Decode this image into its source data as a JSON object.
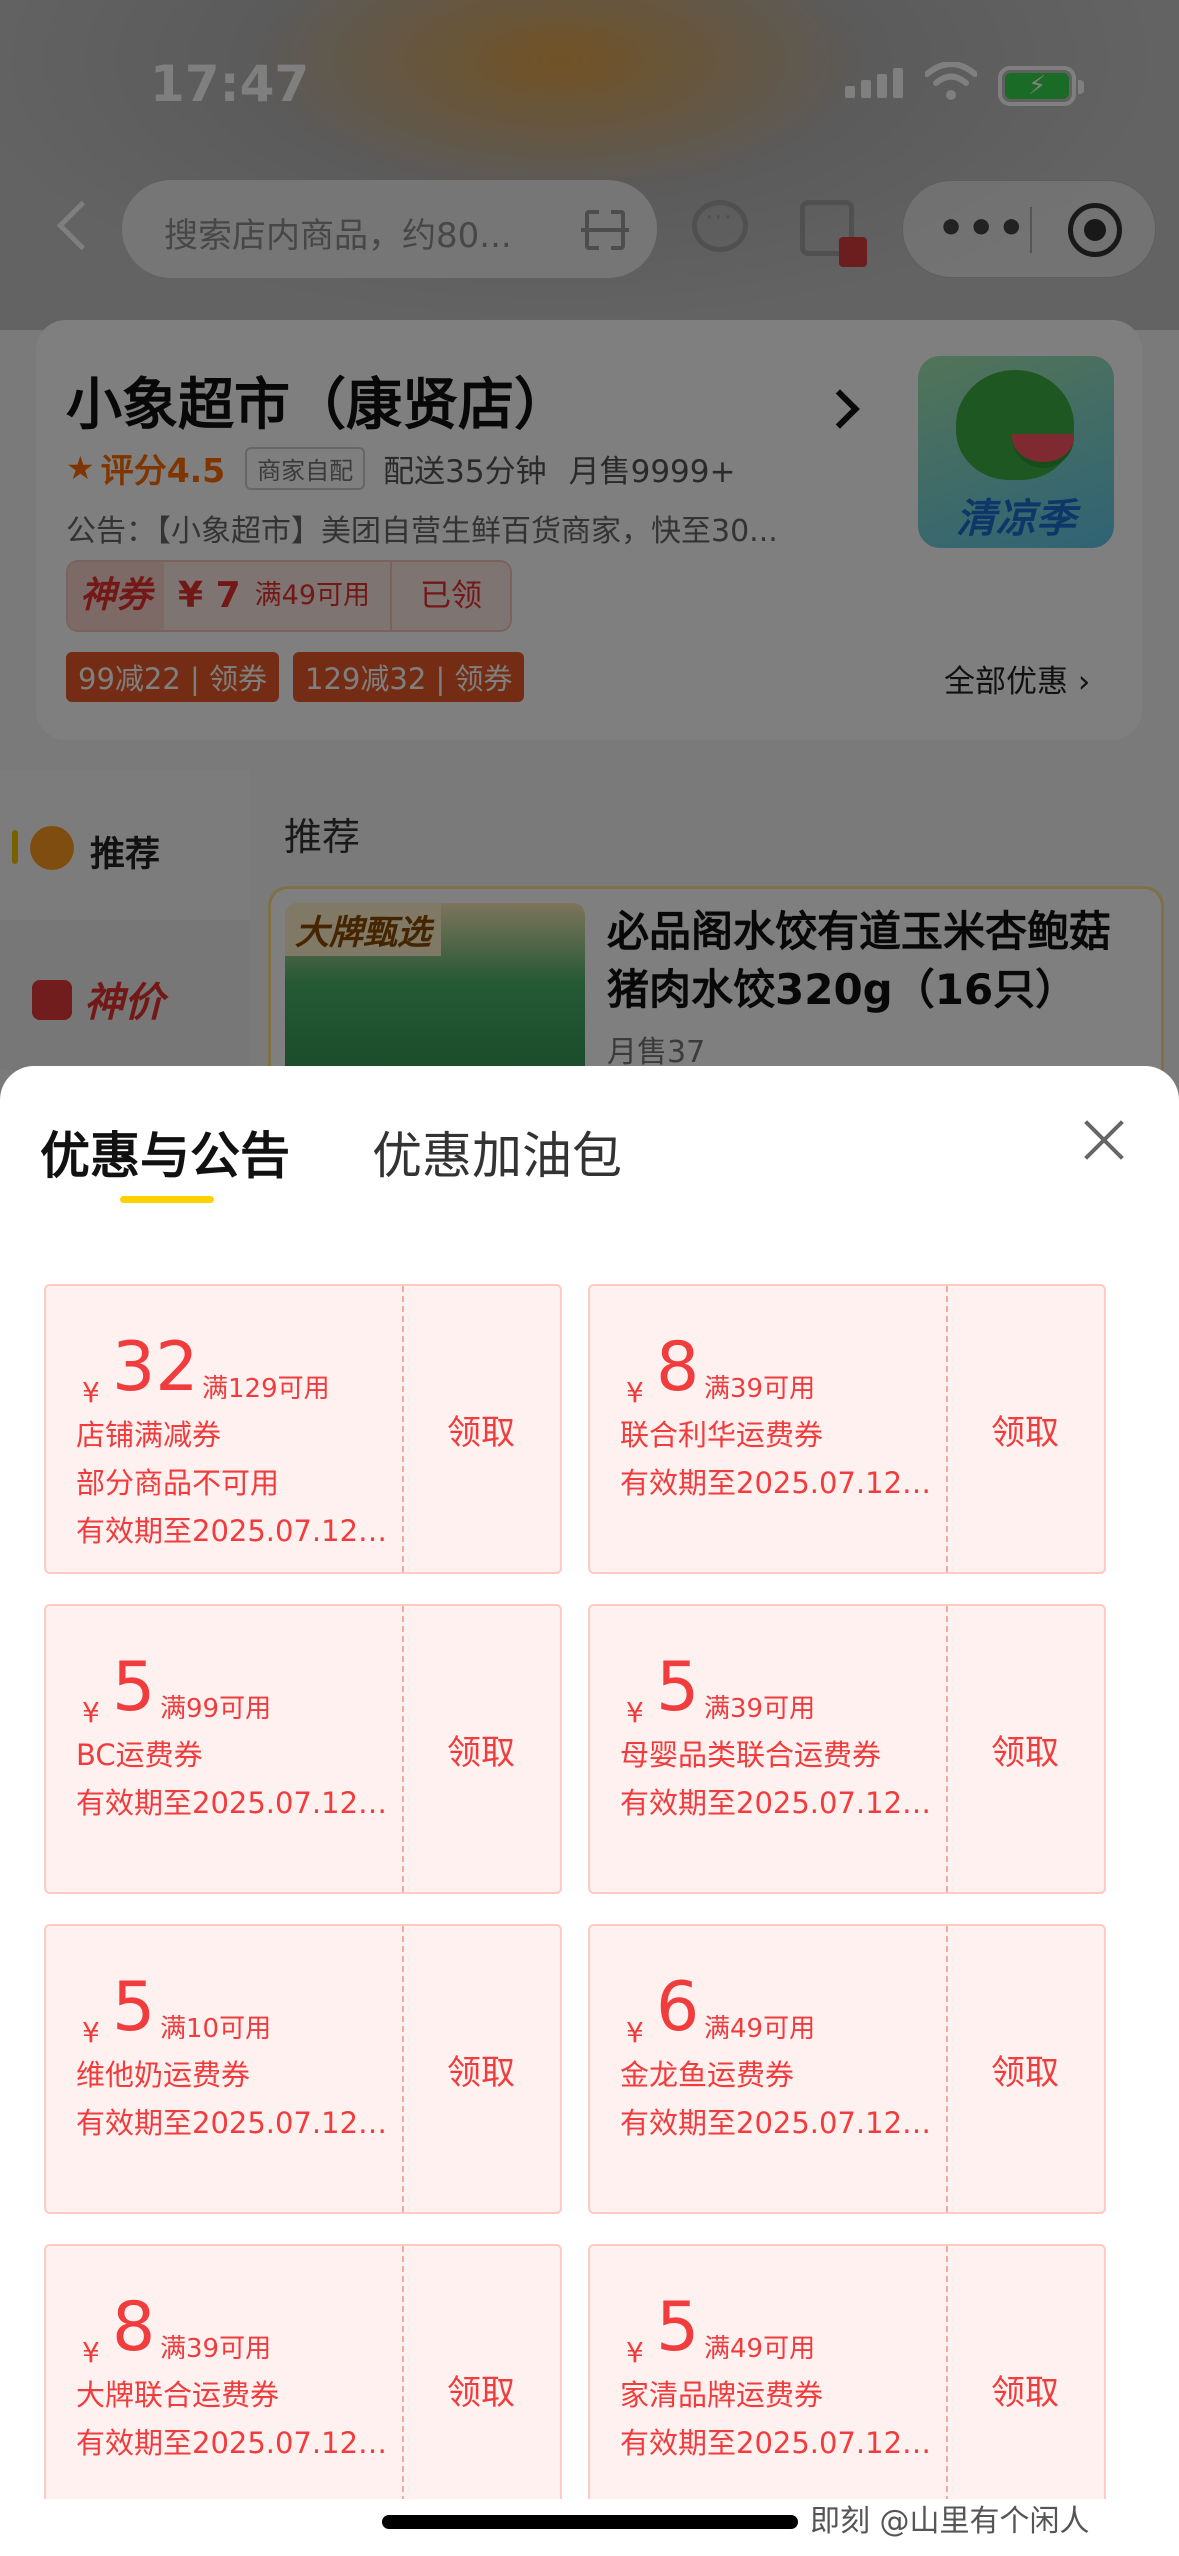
{
  "status_bar": {
    "time": "17:47"
  },
  "nav": {
    "search_placeholder": "搜索店内商品，约80..."
  },
  "shop": {
    "name": "小象超市（康贤店）",
    "rating": "评分4.5",
    "self_delivery": "商家自配",
    "delivery_time": "配送35分钟",
    "monthly_sales": "月售9999+",
    "notice": "公告：【小象超市】美团自营生鲜百货商家，快至30...",
    "logo_text": "清凉季",
    "god_coupon": {
      "tag": "神券",
      "amount": "¥ 7",
      "condition": "满49可用",
      "status": "已领"
    },
    "coupon_tags": [
      "99减22 | 领券",
      "129减32 | 领券"
    ],
    "all_offers": "全部优惠 ›"
  },
  "side_nav": {
    "recommend": "推荐",
    "deal": "神价"
  },
  "recommend_section": {
    "title": "推荐",
    "product": {
      "badge": "大牌甄选",
      "name": "必品阁水饺有道玉米杏鲍菇猪肉水饺320g（16只）",
      "sold": "月售37"
    }
  },
  "sheet": {
    "tab_active": "优惠与公告",
    "tab_inactive": "优惠加油包",
    "claim_label": "领取",
    "currency": "¥",
    "coupons": [
      {
        "amount": "32",
        "condition": "满129可用",
        "line1": "店铺满减券",
        "line2": "部分商品不可用",
        "line3": "有效期至2025.07.12 ..."
      },
      {
        "amount": "8",
        "condition": "满39可用",
        "line1": "联合利华运费券",
        "line2": "有效期至2025.07.12 ..."
      },
      {
        "amount": "5",
        "condition": "满99可用",
        "line1": "BC运费券",
        "line2": "有效期至2025.07.12 ..."
      },
      {
        "amount": "5",
        "condition": "满39可用",
        "line1": "母婴品类联合运费券",
        "line2": "有效期至2025.07.12 ..."
      },
      {
        "amount": "5",
        "condition": "满10可用",
        "line1": "维他奶运费券",
        "line2": "有效期至2025.07.12 ..."
      },
      {
        "amount": "6",
        "condition": "满49可用",
        "line1": "金龙鱼运费券",
        "line2": "有效期至2025.07.12 ..."
      },
      {
        "amount": "8",
        "condition": "满39可用",
        "line1": "大牌联合运费券",
        "line2": "有效期至2025.07.12 ..."
      },
      {
        "amount": "5",
        "condition": "满49可用",
        "line1": "家清品牌运费券",
        "line2": "有效期至2025.07.12 ..."
      }
    ]
  },
  "watermark": "即刻 @山里有个闲人"
}
